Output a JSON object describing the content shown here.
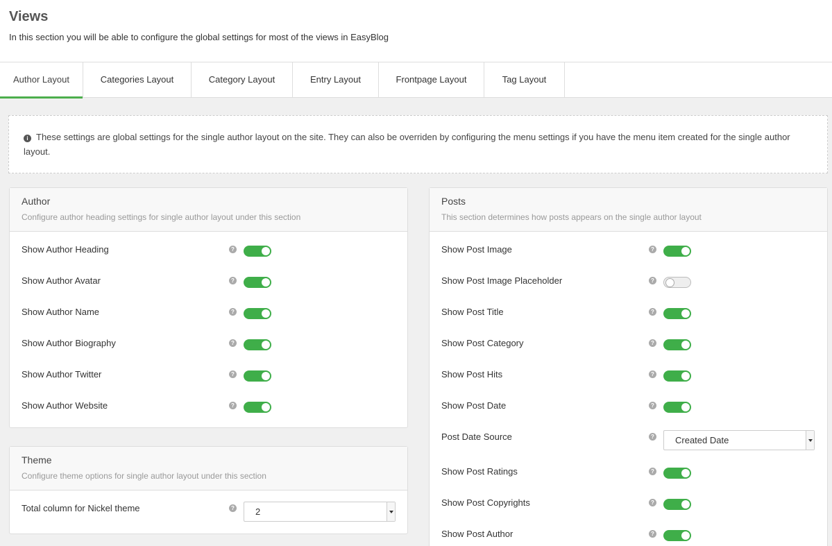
{
  "header": {
    "title": "Views",
    "description": "In this section you will be able to configure the global settings for most of the views in EasyBlog"
  },
  "tabs": [
    {
      "label": "Author Layout",
      "active": true
    },
    {
      "label": "Categories Layout",
      "active": false
    },
    {
      "label": "Category Layout",
      "active": false
    },
    {
      "label": "Entry Layout",
      "active": false
    },
    {
      "label": "Frontpage Layout",
      "active": false
    },
    {
      "label": "Tag Layout",
      "active": false
    }
  ],
  "notice": {
    "icon": "info-icon",
    "text": "These settings are global settings for the single author layout on the site. They can also be overriden by configuring the menu settings if you have the menu item created for the single author layout."
  },
  "author_panel": {
    "title": "Author",
    "subtitle": "Configure author heading settings for single author layout under this section",
    "rows": [
      {
        "label": "Show Author Heading",
        "enabled": true
      },
      {
        "label": "Show Author Avatar",
        "enabled": true
      },
      {
        "label": "Show Author Name",
        "enabled": true
      },
      {
        "label": "Show Author Biography",
        "enabled": true
      },
      {
        "label": "Show Author Twitter",
        "enabled": true
      },
      {
        "label": "Show Author Website",
        "enabled": true
      }
    ]
  },
  "theme_panel": {
    "title": "Theme",
    "subtitle": "Configure theme options for single author layout under this section",
    "rows": [
      {
        "label": "Total column for Nickel theme",
        "value": "2"
      }
    ]
  },
  "posts_panel": {
    "title": "Posts",
    "subtitle": "This section determines how posts appears on the single author layout",
    "rows": [
      {
        "label": "Show Post Image",
        "enabled": true
      },
      {
        "label": "Show Post Image Placeholder",
        "enabled": false
      },
      {
        "label": "Show Post Title",
        "enabled": true
      },
      {
        "label": "Show Post Category",
        "enabled": true
      },
      {
        "label": "Show Post Hits",
        "enabled": true
      },
      {
        "label": "Show Post Date",
        "enabled": true
      },
      {
        "label": "Post Date Source",
        "value": "Created Date"
      },
      {
        "label": "Show Post Ratings",
        "enabled": true
      },
      {
        "label": "Show Post Copyrights",
        "enabled": true
      },
      {
        "label": "Show Post Author",
        "enabled": true
      }
    ]
  },
  "colors": {
    "accent": "#4cae4c",
    "toggle_on": "#3fae49"
  }
}
